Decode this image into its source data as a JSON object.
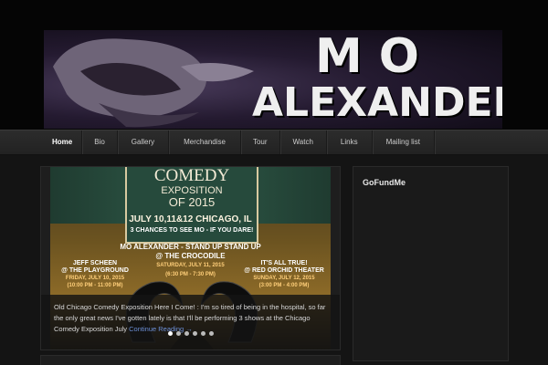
{
  "header": {
    "title_line1": "MO",
    "title_line2": "ALEXANDER"
  },
  "nav": {
    "items": [
      {
        "label": "Home",
        "active": true
      },
      {
        "label": "Bio"
      },
      {
        "label": "Gallery"
      },
      {
        "label": "Merchandise"
      },
      {
        "label": "Tour"
      },
      {
        "label": "Watch"
      },
      {
        "label": "Links"
      },
      {
        "label": "Mailing list"
      }
    ]
  },
  "slider": {
    "poster": {
      "title_line1": "COMEDY",
      "title_line2": "EXPOSITION",
      "title_line3": "OF 2015",
      "dates": "JULY 10,11&12  CHICAGO, IL",
      "chances": "3 CHANCES TO SEE MO - IF YOU DARE!",
      "mo_line1": "MO ALEXANDER - STAND UP STAND UP",
      "mo_line2": "@ THE CROCODILE",
      "mo_date": "SATURDAY, JULY 11, 2015",
      "mo_time": "(6:30 PM - 7:30 PM)",
      "venue_left_1": "JEFF SCHEEN",
      "venue_left_2": "@ THE PLAYGROUND",
      "venue_left_date": "FRIDAY, JULY 10, 2015",
      "venue_left_time": "(10:00 PM - 11:00 PM)",
      "venue_right_1": "IT'S ALL TRUE!",
      "venue_right_2": "@ RED ORCHID THEATER",
      "venue_right_date": "SUNDAY, JULY 12, 2015",
      "venue_right_time": "(3:00 PM - 4:00 PM)"
    },
    "caption": "Old Chicago Comedy Exposition Here I Come! : I'm so tired of being in the hospital, so far the only great news I've gotten lately is that I'll be performing 3 shows at the Chicago Comedy Exposition July",
    "read_more": "Continue Reading →",
    "dots_count": 6,
    "active_dot": 0
  },
  "sidebar": {
    "title": "GoFundMe"
  }
}
